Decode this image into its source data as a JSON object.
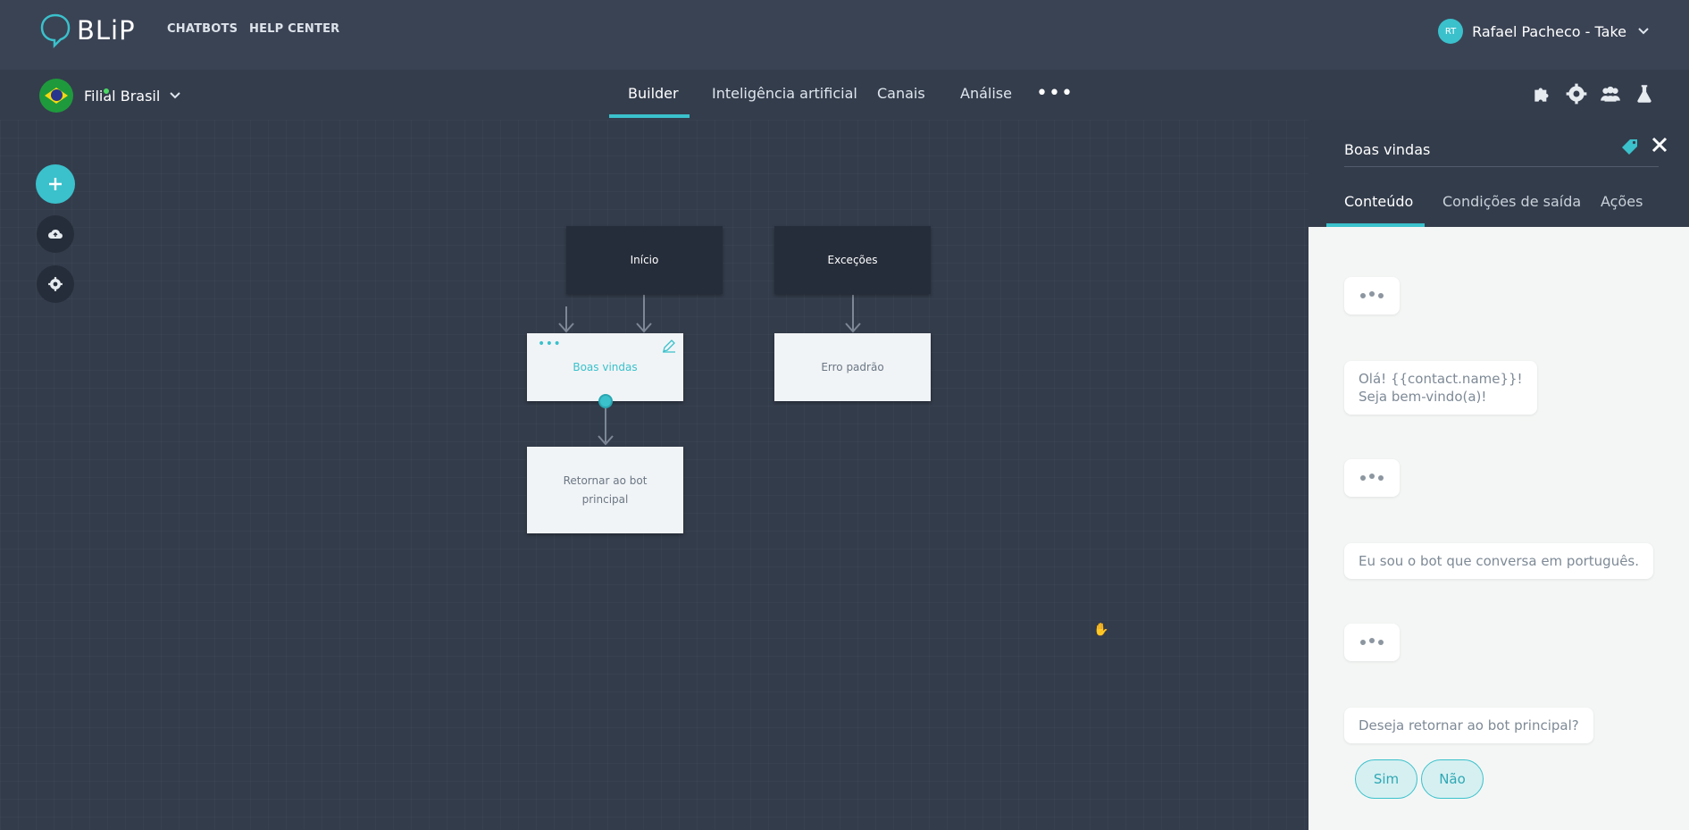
{
  "brand": {
    "logo_text": "BLiP",
    "accent": "#3ac1cc"
  },
  "topnav": {
    "links": [
      "CHATBOTS",
      "HELP CENTER"
    ],
    "user": {
      "initials": "RT",
      "name": "Rafael Pacheco - Take"
    }
  },
  "subnav": {
    "bot_name": "Filial Brasil",
    "tabs": [
      "Builder",
      "Inteligência artificial",
      "Canais",
      "Análise"
    ],
    "active_tab": "Builder",
    "more_icon": "more-horizontal-icon",
    "right_icons": [
      "puzzle-icon",
      "gear-icon",
      "users-icon",
      "flask-icon"
    ]
  },
  "canvas": {
    "blocks": {
      "inicio": "Início",
      "excecoes": "Exceções",
      "boas_vindas": "Boas vindas",
      "erro_padrao": "Erro padrão",
      "retornar": "Retornar ao bot principal"
    },
    "side_buttons": [
      "add-icon",
      "cloud-upload-icon",
      "gear-icon"
    ]
  },
  "panel": {
    "title": "Boas vindas",
    "tabs": [
      "Conteúdo",
      "Condições de saída",
      "Ações"
    ],
    "active_tab": "Conteúdo",
    "messages": [
      "Olá! {{contact.name}}!",
      "Seja bem-vindo(a)!",
      "Eu sou o bot que conversa em português.",
      "Deseja retornar ao bot principal?"
    ],
    "quick_replies": [
      "Sim",
      "Não"
    ]
  }
}
